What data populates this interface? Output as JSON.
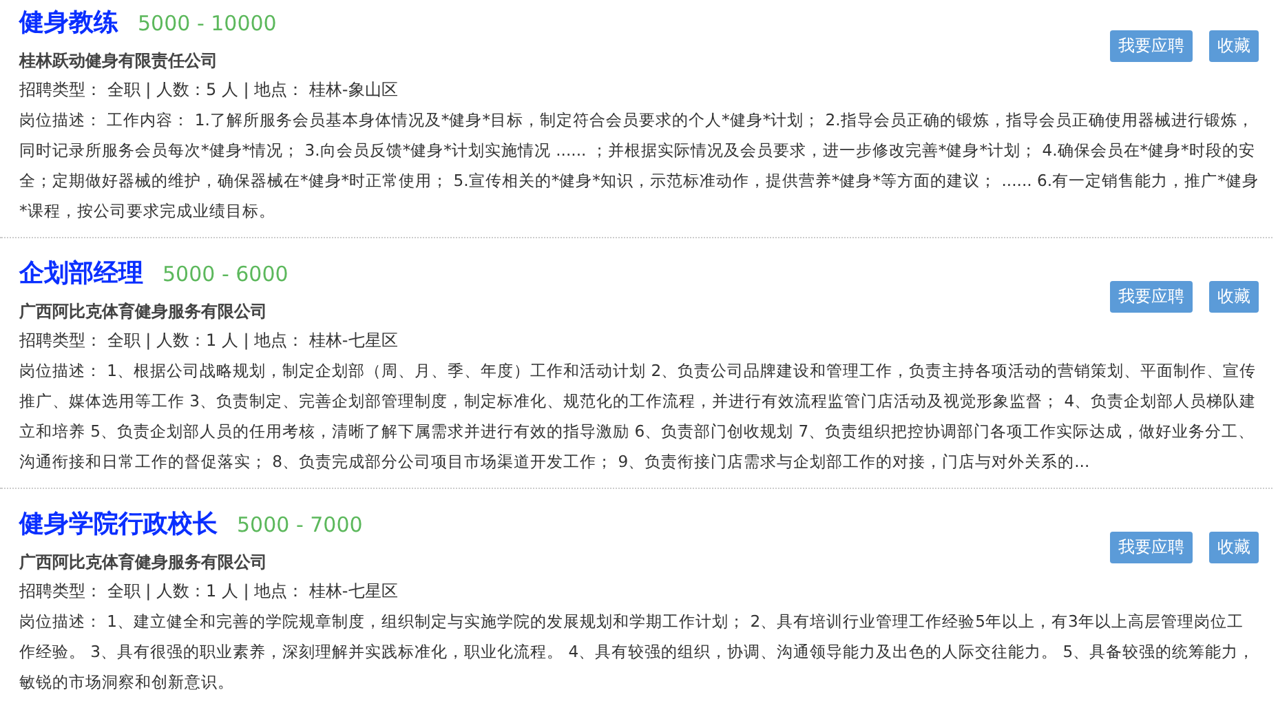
{
  "jobs": [
    {
      "title": "健身教练",
      "salary": "5000 - 10000",
      "company": "桂林跃动健身有限责任公司",
      "meta": "招聘类型： 全职 | 人数：5 人 | 地点： 桂林-象山区",
      "description": "岗位描述： 工作内容： 1.了解所服务会员基本身体情况及*健身*目标，制定符合会员要求的个人*健身*计划； 2.指导会员正确的锻炼，指导会员正确使用器械进行锻炼，同时记录所服务会员每次*健身*情况； 3.向会员反馈*健身*计划实施情况 ...... ；并根据实际情况及会员要求，进一步修改完善*健身*计划； 4.确保会员在*健身*时段的安全；定期做好器械的维护，确保器械在*健身*时正常使用； 5.宣传相关的*健身*知识，示范标准动作，提供营养*健身*等方面的建议； ...... 6.有一定销售能力，推广*健身*课程，按公司要求完成业绩目标。",
      "buttons": [
        "我要应聘",
        "收藏"
      ]
    },
    {
      "title": "企划部经理",
      "salary": "5000 - 6000",
      "company": "广西阿比克体育健身服务有限公司",
      "meta": "招聘类型： 全职 | 人数：1 人 | 地点： 桂林-七星区",
      "description": "岗位描述： 1、根据公司战略规划，制定企划部（周、月、季、年度）工作和活动计划 2、负责公司品牌建设和管理工作，负责主持各项活动的营销策划、平面制作、宣传推广、媒体选用等工作 3、负责制定、完善企划部管理制度，制定标准化、规范化的工作流程，并进行有效流程监管门店活动及视觉形象监督； 4、负责企划部人员梯队建立和培养 5、负责企划部人员的任用考核，清晰了解下属需求并进行有效的指导激励 6、负责部门创收规划 7、负责组织把控协调部门各项工作实际达成，做好业务分工、沟通衔接和日常工作的督促落实； 8、负责完成部分公司项目市场渠道开发工作； 9、负责衔接门店需求与企划部工作的对接，门店与对外关系的...",
      "buttons": [
        "我要应聘",
        "收藏"
      ]
    },
    {
      "title": "健身学院行政校长",
      "salary": "5000 - 7000",
      "company": "广西阿比克体育健身服务有限公司",
      "meta": "招聘类型： 全职 | 人数：1 人 | 地点： 桂林-七星区",
      "description": "岗位描述： 1、建立健全和完善的学院规章制度，组织制定与实施学院的发展规划和学期工作计划； 2、具有培训行业管理工作经验5年以上，有3年以上高层管理岗位工作经验。 3、具有很强的职业素养，深刻理解并实践标准化，职业化流程。 4、具有较强的组织，协调、沟通领导能力及出色的人际交往能力。 5、具备较强的统筹能力，敏锐的市场洞察和创新意识。",
      "buttons": [
        "我要应聘",
        "收藏"
      ]
    }
  ]
}
